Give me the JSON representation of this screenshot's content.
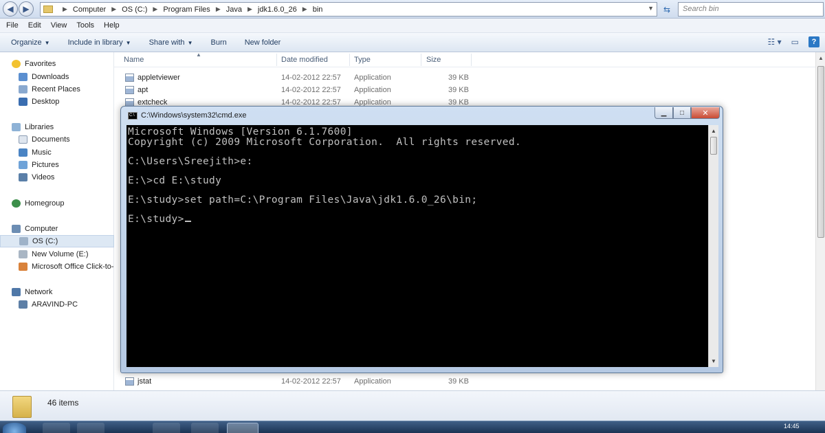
{
  "explorer": {
    "address": {
      "crumbs": [
        "Computer",
        "OS (C:)",
        "Program Files",
        "Java",
        "jdk1.6.0_26",
        "bin"
      ]
    },
    "search_placeholder": "Search bin",
    "menu": [
      "File",
      "Edit",
      "View",
      "Tools",
      "Help"
    ],
    "toolbar": {
      "organize": "Organize",
      "include_in_library": "Include in library",
      "share_with": "Share with",
      "burn": "Burn",
      "new_folder": "New folder"
    },
    "columns": {
      "name": "Name",
      "date_modified": "Date modified",
      "type": "Type",
      "size": "Size"
    },
    "files": [
      {
        "name": "appletviewer",
        "date": "14-02-2012 22:57",
        "type": "Application",
        "size": "39 KB"
      },
      {
        "name": "apt",
        "date": "14-02-2012 22:57",
        "type": "Application",
        "size": "39 KB"
      },
      {
        "name": "extcheck",
        "date": "14-02-2012 22:57",
        "type": "Application",
        "size": "39 KB"
      },
      {
        "name": "jstat",
        "date": "14-02-2012 22:57",
        "type": "Application",
        "size": "39 KB"
      }
    ],
    "nav": {
      "favorites": "Favorites",
      "downloads": "Downloads",
      "recent_places": "Recent Places",
      "desktop": "Desktop",
      "libraries": "Libraries",
      "documents": "Documents",
      "music": "Music",
      "pictures": "Pictures",
      "videos": "Videos",
      "homegroup": "Homegroup",
      "computer": "Computer",
      "os_c": "OS (C:)",
      "new_volume": "New Volume (E:)",
      "ms_office": "Microsoft Office Click-to-",
      "network": "Network",
      "aravind_pc": "ARAVIND-PC"
    },
    "status": {
      "item_count": "46 items"
    }
  },
  "cmd": {
    "title": "C:\\Windows\\system32\\cmd.exe",
    "icon_text": "C:\\",
    "lines": [
      "Microsoft Windows [Version 6.1.7600]",
      "Copyright (c) 2009 Microsoft Corporation.  All rights reserved.",
      "C:\\Users\\Sreejith>e:",
      "E:\\>cd E:\\study",
      "E:\\study>set path=C:\\Program Files\\Java\\jdk1.6.0_26\\bin;",
      "E:\\study>"
    ]
  },
  "taskbar": {
    "clock": "14:45"
  },
  "colors": {
    "console_bg": "#000000",
    "console_text": "#c0c0c0",
    "close_button": "#c94a33",
    "nav_selected": "#dde8f4"
  }
}
